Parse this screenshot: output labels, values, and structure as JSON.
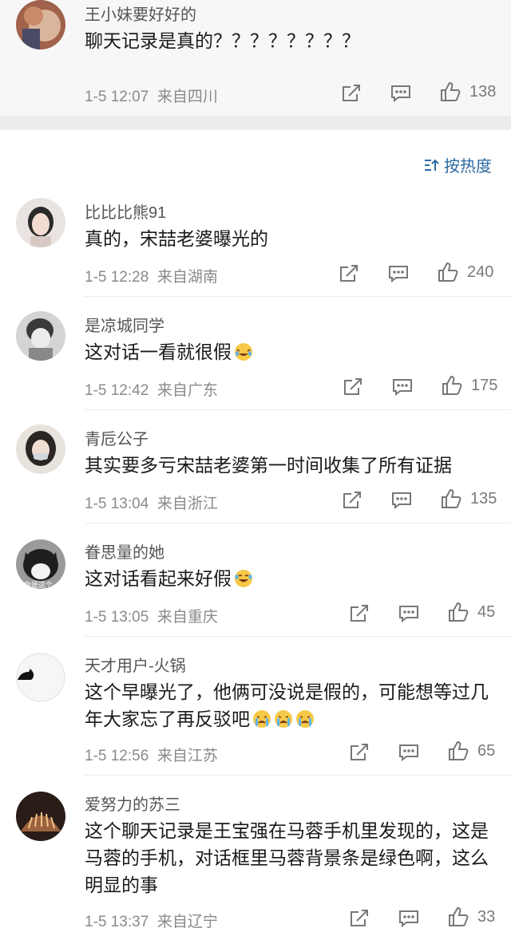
{
  "comments": [
    {
      "name": "王小妹要好好的",
      "text": "聊天记录是真的？？？？？？？？",
      "date": "1-5 12:07",
      "location": "来自四川",
      "likes": "138"
    },
    {
      "name": "比比比熊91",
      "text": "真的，宋喆老婆曝光的",
      "date": "1-5 12:28",
      "location": "来自湖南",
      "likes": "240"
    },
    {
      "name": "是凉城同学",
      "text": "这对话一看就很假",
      "date": "1-5 12:42",
      "location": "来自广东",
      "likes": "175"
    },
    {
      "name": "青卮公子",
      "text": "其实要多亏宋喆老婆第一时间收集了所有证据",
      "date": "1-5 13:04",
      "location": "来自浙江",
      "likes": "135"
    },
    {
      "name": "眷思量的她",
      "text": "这对话看起来好假",
      "date": "1-5 13:05",
      "location": "来自重庆",
      "likes": "45"
    },
    {
      "name": "天才用户-火锅",
      "text": "这个早曝光了，他俩可没说是假的，可能想等过几年大家忘了再反驳吧",
      "date": "1-5 12:56",
      "location": "来自江苏",
      "likes": "65"
    },
    {
      "name": "爱努力的苏三",
      "text": "这个聊天记录是王宝强在马蓉手机里发现的，这是马蓉的手机，对话框里马蓉背景条是绿色啊，这么明显的事",
      "date": "1-5 13:37",
      "location": "来自辽宁",
      "likes": "33"
    }
  ],
  "sort": {
    "label": "按热度"
  },
  "avatar_captions": {
    "c4": "你是这个"
  },
  "colors": {
    "accent": "#2d6aa3",
    "meta": "#8a8a8a"
  },
  "icons": [
    "share-icon",
    "comment-icon",
    "like-icon",
    "sort-icon"
  ]
}
